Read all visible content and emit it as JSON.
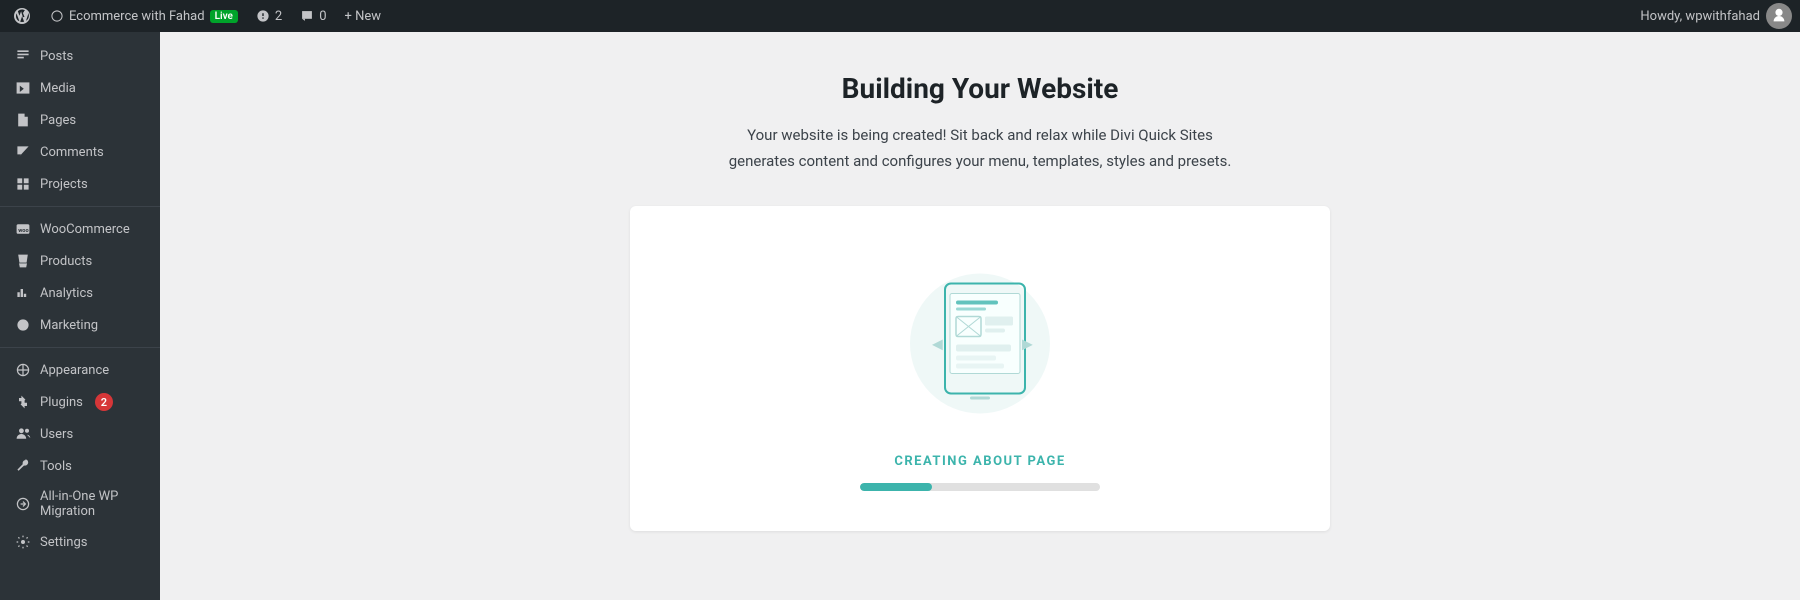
{
  "topbar": {
    "site_name": "Ecommerce with Fahad",
    "live_label": "Live",
    "updates_count": "2",
    "comments_count": "0",
    "new_label": "+ New",
    "howdy_text": "Howdy, wpwithfahad"
  },
  "sidebar": {
    "items": [
      {
        "id": "posts",
        "label": "Posts",
        "icon": "posts-icon"
      },
      {
        "id": "media",
        "label": "Media",
        "icon": "media-icon"
      },
      {
        "id": "pages",
        "label": "Pages",
        "icon": "pages-icon"
      },
      {
        "id": "comments",
        "label": "Comments",
        "icon": "comments-icon"
      },
      {
        "id": "projects",
        "label": "Projects",
        "icon": "projects-icon"
      },
      {
        "id": "woocommerce",
        "label": "WooCommerce",
        "icon": "woo-icon"
      },
      {
        "id": "products",
        "label": "Products",
        "icon": "products-icon"
      },
      {
        "id": "analytics",
        "label": "Analytics",
        "icon": "analytics-icon"
      },
      {
        "id": "marketing",
        "label": "Marketing",
        "icon": "marketing-icon"
      },
      {
        "id": "appearance",
        "label": "Appearance",
        "icon": "appearance-icon"
      },
      {
        "id": "plugins",
        "label": "Plugins",
        "icon": "plugins-icon",
        "badge": "2"
      },
      {
        "id": "users",
        "label": "Users",
        "icon": "users-icon"
      },
      {
        "id": "tools",
        "label": "Tools",
        "icon": "tools-icon"
      },
      {
        "id": "allinone",
        "label": "All-in-One WP Migration",
        "icon": "migration-icon"
      },
      {
        "id": "settings",
        "label": "Settings",
        "icon": "settings-icon"
      }
    ]
  },
  "main": {
    "title": "Building Your Website",
    "subtitle": "Your website is being created! Sit back and relax while Divi Quick Sites generates content and configures your menu, templates, styles and presets.",
    "card": {
      "creating_label": "CREATING ABOUT PAGE",
      "progress_percent": 30
    }
  }
}
